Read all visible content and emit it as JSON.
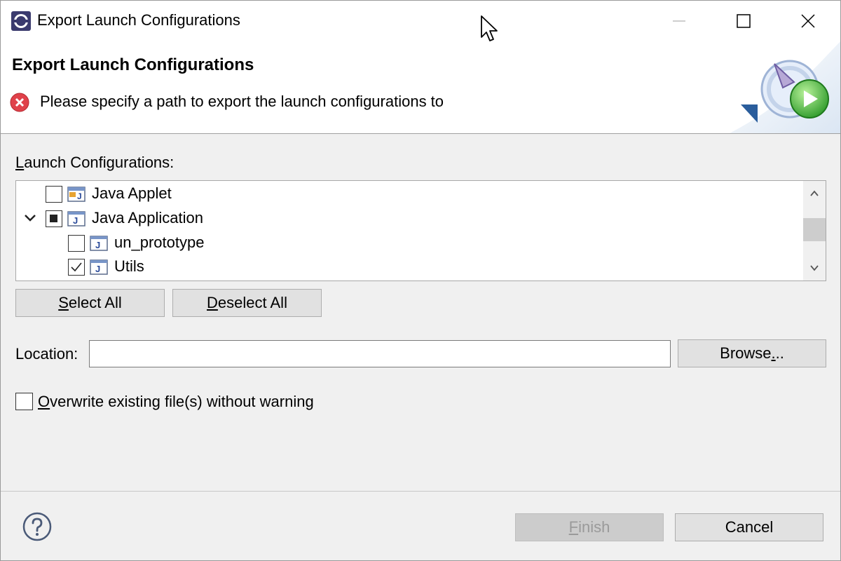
{
  "window": {
    "title": "Export Launch Configurations"
  },
  "banner": {
    "title": "Export Launch Configurations",
    "message": "Please specify a path to export the launch configurations to",
    "message_icon": "error-icon"
  },
  "tree": {
    "label_mnemonic": "L",
    "label_rest": "aunch Configurations:",
    "items": [
      {
        "label": "Java Applet",
        "icon": "java-applet-icon",
        "checked": "unchecked",
        "level": 0,
        "expanded": false
      },
      {
        "label": "Java Application",
        "icon": "java-application-icon",
        "checked": "partial",
        "level": 0,
        "expanded": true
      },
      {
        "label": "un_prototype",
        "icon": "java-application-icon",
        "checked": "unchecked",
        "level": 1
      },
      {
        "label": "Utils",
        "icon": "java-application-icon",
        "checked": "checked",
        "level": 1
      }
    ]
  },
  "buttons": {
    "select_all_mnemonic": "S",
    "select_all_rest": "elect All",
    "deselect_all_mnemonic": "D",
    "deselect_all_rest": "eselect All",
    "browse_before": "Browse",
    "browse_mnemonic": ".",
    "browse_after": "..",
    "finish_mnemonic": "F",
    "finish_rest": "inish",
    "cancel": "Cancel"
  },
  "location": {
    "label": "Location:",
    "value": ""
  },
  "overwrite": {
    "mnemonic": "O",
    "rest": "verwrite existing file(s) without warning",
    "checked": false
  },
  "colors": {
    "error_red": "#e0414a",
    "finish_disabled_text": "#9a9a9a"
  }
}
